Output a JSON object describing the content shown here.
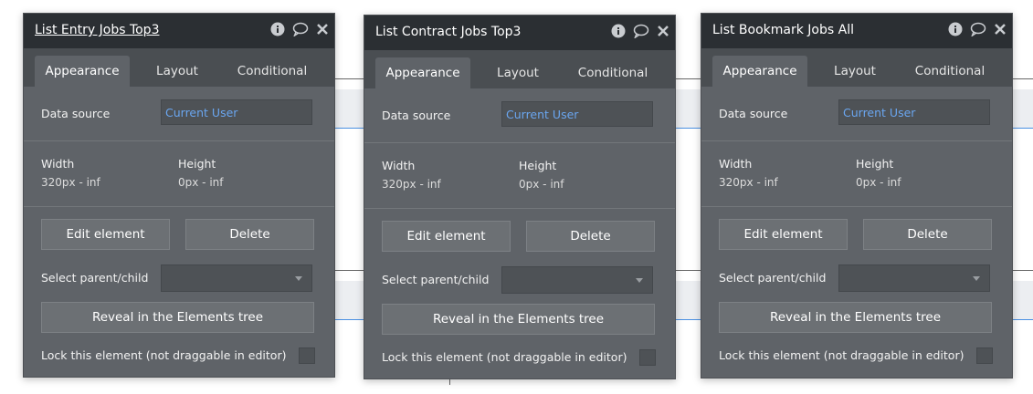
{
  "panels": [
    {
      "title": "List Entry Jobs Top3",
      "tabs": [
        "Appearance",
        "Layout",
        "Conditional"
      ],
      "data_source_label": "Data source",
      "data_source_value": "Current User",
      "width_label": "Width",
      "width_value": "320px - inf",
      "height_label": "Height",
      "height_value": "0px - inf",
      "edit_label": "Edit element",
      "delete_label": "Delete",
      "select_parent_label": "Select parent/child",
      "reveal_label": "Reveal in the Elements tree",
      "lock_label": "Lock this element (not draggable in editor)"
    },
    {
      "title": "List Contract Jobs Top3",
      "tabs": [
        "Appearance",
        "Layout",
        "Conditional"
      ],
      "data_source_label": "Data source",
      "data_source_value": "Current User",
      "width_label": "Width",
      "width_value": "320px - inf",
      "height_label": "Height",
      "height_value": "0px - inf",
      "edit_label": "Edit element",
      "delete_label": "Delete",
      "select_parent_label": "Select parent/child",
      "reveal_label": "Reveal in the Elements tree",
      "lock_label": "Lock this element (not draggable in editor)"
    },
    {
      "title": "List Bookmark Jobs All",
      "tabs": [
        "Appearance",
        "Layout",
        "Conditional"
      ],
      "data_source_label": "Data source",
      "data_source_value": "Current User",
      "width_label": "Width",
      "width_value": "320px - inf",
      "height_label": "Height",
      "height_value": "0px - inf",
      "edit_label": "Edit element",
      "delete_label": "Delete",
      "select_parent_label": "Select parent/child",
      "reveal_label": "Reveal in the Elements tree",
      "lock_label": "Lock this element (not draggable in editor)"
    }
  ],
  "icons": [
    "info-icon",
    "comment-icon",
    "close-icon",
    "chevron-down-icon"
  ],
  "colors": {
    "panel_bg": "#5f6368",
    "header_bg": "#2b2f33",
    "data_source_text": "#6aa6f0",
    "canvas_line_blue": "#4a90e2"
  }
}
